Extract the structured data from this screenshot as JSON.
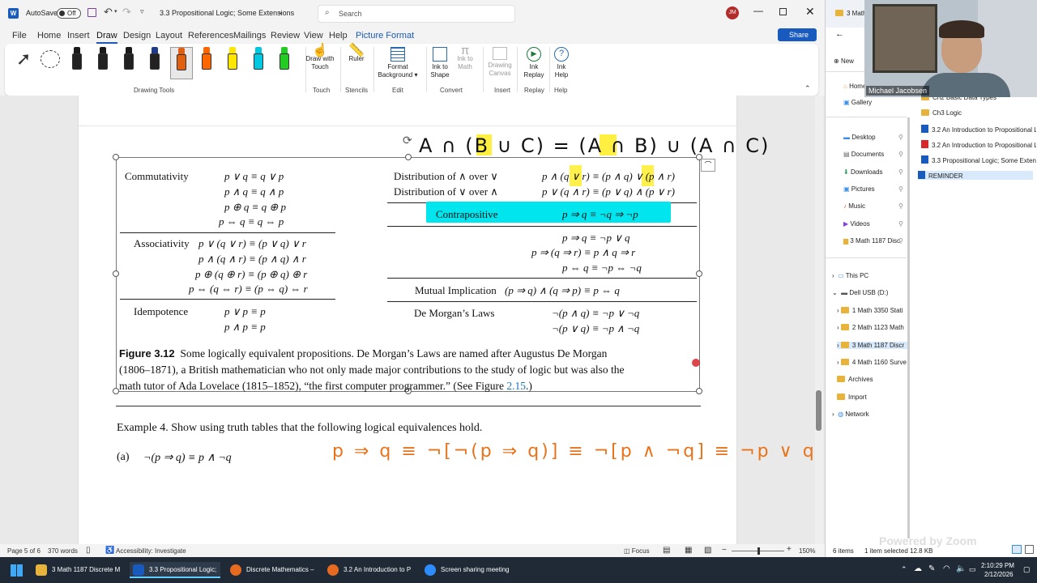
{
  "title_bar": {
    "autosave_label": "AutoSave",
    "autosave_state": "Off",
    "doc_title": "3.3 Propositional Logic; Some Extensions",
    "search_placeholder": "Search",
    "user_initials": "JM"
  },
  "ribbon_tabs": [
    "File",
    "Home",
    "Insert",
    "Draw",
    "Design",
    "Layout",
    "References",
    "Mailings",
    "Review",
    "View",
    "Help",
    "Picture Format"
  ],
  "active_tab": "Draw",
  "share_label": "Share",
  "ribbon": {
    "groups": [
      {
        "name": "Drawing Tools"
      },
      {
        "name": "Touch",
        "buttons": [
          "Draw with Touch"
        ]
      },
      {
        "name": "Stencils",
        "buttons": [
          "Ruler"
        ]
      },
      {
        "name": "Edit",
        "buttons": [
          "Format Background"
        ]
      },
      {
        "name": "Convert",
        "buttons": [
          "Ink to Shape",
          "Ink to Math"
        ]
      },
      {
        "name": "Insert",
        "buttons": [
          "Drawing Canvas"
        ]
      },
      {
        "name": "Replay",
        "buttons": [
          "Ink Replay"
        ]
      },
      {
        "name": "Help",
        "buttons": [
          "Ink Help"
        ]
      }
    ],
    "pen_colors": [
      "#1a1a1a",
      "#1a1a1a",
      "#1a1a1a",
      "#1e3a8a",
      "#e06010",
      "#ff6600",
      "#ffe600",
      "#00c8e0",
      "#22cc22"
    ]
  },
  "handwriting": {
    "top_equation": "A ∩ (B ∪ C) = (A ∩ B) ∪ (A ∩ C)",
    "bottom_equation": "p ⇒ q ≡ ¬[¬(p ⇒ q)] ≡ ¬[p ∧ ¬q] ≡ ¬p ∨ q",
    "ink_color": "#e8731a"
  },
  "figure": {
    "left": [
      {
        "name": "Commutativity",
        "rows": [
          "p ∨ q ≡ q ∨ p",
          "p ∧ q ≡ q ∧ p",
          "p ⊕ q ≡ q ⊕ p",
          "p ⇔ q ≡ q ⇔ p"
        ]
      },
      {
        "name": "Associativity",
        "rows": [
          "p ∨ (q ∨ r) ≡ (p ∨ q) ∨ r",
          "p ∧ (q ∧ r) ≡ (p ∧ q) ∧ r",
          "p ⊕ (q ⊕ r) ≡ (p ⊕ q) ⊕ r",
          "p ⇔ (q ⇔ r) ≡ (p ⇔ q) ⇔ r"
        ]
      },
      {
        "name": "Idempotence",
        "rows": [
          "p ∨ p ≡ p",
          "p ∧ p ≡ p"
        ]
      }
    ],
    "right": {
      "dist1_name": "Distribution of ∧ over ∨",
      "dist1_eq": "p ∧ (q ∨ r) ≡ (p ∧ q) ∨ (p ∧ r)",
      "dist2_name": "Distribution of ∨ over ∧",
      "dist2_eq": "p ∨ (q ∧ r) ≡ (p ∨ q) ∧ (p ∨ r)",
      "contra_name": "Contrapositive",
      "contra_eq": "p ⇒ q ≡ ¬q ⇒ ¬p",
      "impl_rows": [
        "p ⇒ q ≡ ¬p ∨ q",
        "p ⇒ (q ⇒ r) ≡ p ∧ q ⇒ r",
        "p ⇔ q ≡ ¬p ⇔ ¬q"
      ],
      "mutual_name": "Mutual Implication",
      "mutual_eq": "(p ⇒ q) ∧ (q ⇒ p) ≡ p ⇔ q",
      "demorgan_name": "De Morgan’s Laws",
      "demorgan_rows": [
        "¬(p ∧ q) ≡ ¬p ∨ ¬q",
        "¬(p ∨ q) ≡ ¬p ∧ ¬q"
      ]
    },
    "caption_label": "Figure 3.12",
    "caption_line1": "Some logically equivalent propositions. De Morgan’s Laws are named after Augustus De Morgan",
    "caption_line2": "(1806–1871), a British mathematician who not only made major contributions to the study of logic but was also the",
    "caption_line3_pre": "math tutor of Ada Lovelace (1815–1852), “the first computer programmer.” (See Figure",
    "caption_link": "2.15",
    "caption_line3_post": ".)"
  },
  "example": {
    "heading": "Example 4.  Show using truth tables that the following logical equivalences hold.",
    "part_label": "(a)",
    "part_expr": "¬(p ⇒ q) ≡ p ∧ ¬q"
  },
  "status_bar": {
    "page": "Page 5 of 6",
    "words": "370 words",
    "accessibility": "Accessibility: Investigate",
    "focus": "Focus",
    "zoom": "150%"
  },
  "explorer": {
    "top_folder": "3 Math",
    "new_label": "New",
    "quick_access": [
      "Home",
      "Gallery"
    ],
    "pinned": [
      "Desktop",
      "Documents",
      "Downloads",
      "Pictures",
      "Music",
      "Videos",
      "3 Math 1187 Disc"
    ],
    "this_pc": "This PC",
    "drive": "Dell USB (D:)",
    "drive_folders": [
      "1 Math 3350 Stati",
      "2 Math 1123 Math",
      "3 Math 1187 Discr",
      "4 Math 1160 Surve",
      "Archives",
      "Import"
    ],
    "network": "Network",
    "files": [
      "Ch2 Basic Data Types",
      "Ch3 Logic",
      "3.2 An Introduction to Propositional L",
      "3.2 An Introduction to Propositional L",
      "3.3 Propositional Logic; Some Extensi",
      "REMINDER"
    ],
    "status_items": "6 items",
    "status_selected": "1 item selected  12.8 KB",
    "powered_by": "Powered by Zoom"
  },
  "webcam_name": "Michael Jacobsen",
  "taskbar": {
    "items": [
      "3 Math 1187 Discrete M",
      "3.3 Propositional Logic;",
      "Discrete Mathematics –",
      "3.2 An Introduction to P",
      "Screen sharing meeting"
    ],
    "time": "2:10:29 PM",
    "date": "2/12/2026"
  }
}
